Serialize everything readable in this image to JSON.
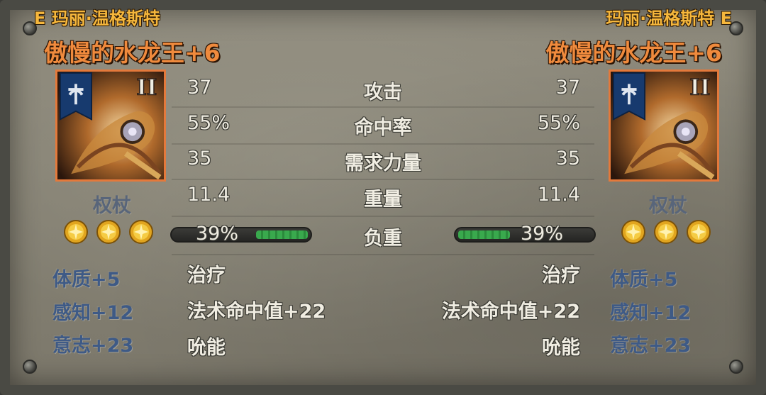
{
  "left": {
    "owner": "E 玛丽·温格斯特",
    "item_name": "傲慢的水龙王+6",
    "item_type": "权杖",
    "tier": "II",
    "gems": [
      "gold-star-gem",
      "gold-star-gem",
      "gold-star-gem"
    ],
    "stats": {
      "attack": "37",
      "hit_rate": "55%",
      "str_req": "35",
      "weight": "11.4"
    },
    "durability": {
      "text": "39%",
      "fraction": 0.39
    },
    "attributes": [
      "体质+5",
      "感知+12",
      "意志+23"
    ],
    "effects": [
      "治疗",
      "法术命中值+22",
      "吮能"
    ]
  },
  "right": {
    "owner": "玛丽·温格斯特 E",
    "item_name": "傲慢的水龙王+6",
    "item_type": "权杖",
    "tier": "II",
    "gems": [
      "gold-star-gem",
      "gold-star-gem",
      "gold-star-gem"
    ],
    "stats": {
      "attack": "37",
      "hit_rate": "55%",
      "str_req": "35",
      "weight": "11.4"
    },
    "durability": {
      "text": "39%",
      "fraction": 0.39
    },
    "attributes": [
      "体质+5",
      "感知+12",
      "意志+23"
    ],
    "effects": [
      "治疗",
      "法术命中值+22",
      "吮能"
    ]
  },
  "labels": {
    "attack": "攻击",
    "hit_rate": "命中率",
    "str_req": "需求力量",
    "weight": "重量",
    "durability": "负重"
  },
  "colors": {
    "owner": "#f6b73c",
    "item_name": "#ef8a3d",
    "attribute": "#3e5a86",
    "durability_fill": "#39a94d",
    "frame": "#e4793b"
  }
}
